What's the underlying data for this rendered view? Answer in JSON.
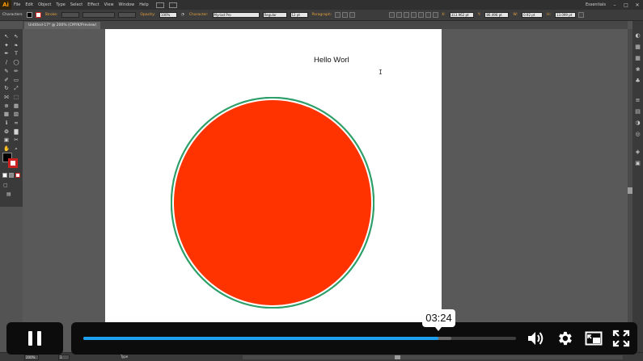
{
  "app": {
    "logo_text": "Ai",
    "menus": [
      "File",
      "Edit",
      "Object",
      "Type",
      "Select",
      "Effect",
      "View",
      "Window",
      "Help"
    ],
    "workspace": "Essentials",
    "window_buttons": [
      "–",
      "□",
      "✕"
    ]
  },
  "control_bar": {
    "panel_label": "Characters",
    "stroke_label": "Stroke:",
    "opacity_label": "Opacity:",
    "opacity_value": "100%",
    "character_label": "Character:",
    "font_name": "Myriad Pro",
    "font_style": "Regular",
    "font_size": "12 pt",
    "paragraph_label": "Paragraph:",
    "x_label": "X:",
    "x_value": "313.962 pt",
    "y_label": "Y:",
    "y_value": "86.496 pt",
    "w_label": "W:",
    "w_value": "0.92 pt",
    "h_label": "H:",
    "h_value": "13.099 pt"
  },
  "document": {
    "tab_title": "Untitled-17* @ 200% (CMYK/Preview)",
    "text_content": "Hello Worl",
    "cursor_glyph": "I"
  },
  "artwork": {
    "circle_fill": "#ff3300",
    "circle_stroke_outer": "#2e9e6a",
    "circle_stroke_gap": "#ffffff"
  },
  "status_bar": {
    "zoom": "200%",
    "artboard_number": "1",
    "tool_name": "Type"
  },
  "player": {
    "current_time": "03:24",
    "progress": 0.82,
    "buffered": 0.85,
    "accent_color": "#1ea0f0",
    "icons": [
      "pause-icon",
      "volume-icon",
      "settings-icon",
      "picture-in-picture-icon",
      "fullscreen-icon"
    ]
  }
}
